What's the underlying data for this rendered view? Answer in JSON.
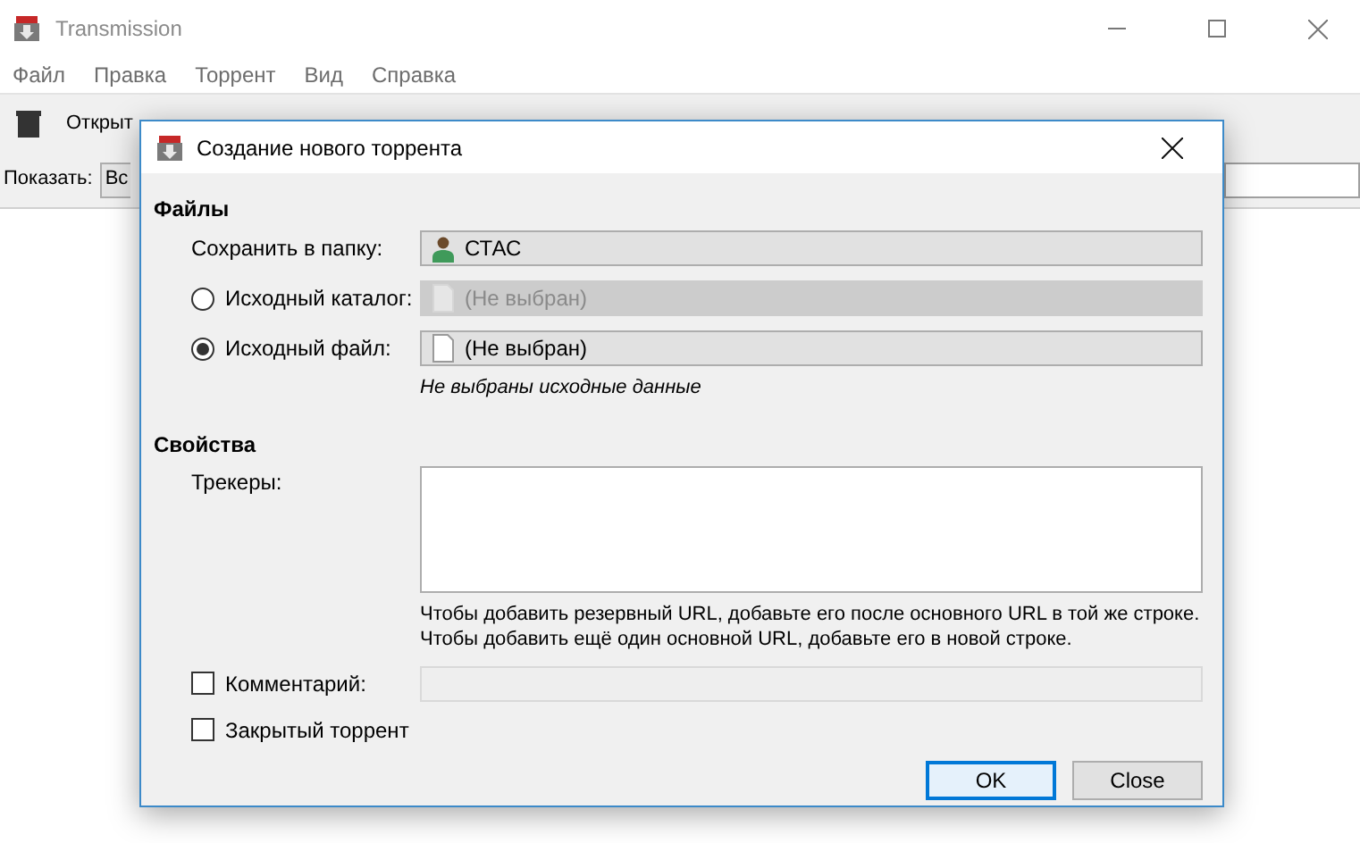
{
  "main_window": {
    "title": "Transmission",
    "menu": [
      "Файл",
      "Правка",
      "Торрент",
      "Вид",
      "Справка"
    ],
    "toolbar": {
      "open_label": "Открыт"
    },
    "filter": {
      "label": "Показать:",
      "value": "Вс"
    }
  },
  "dialog": {
    "title": "Создание нового торрента",
    "files": {
      "heading": "Файлы",
      "rows": [
        {
          "kind": "plain",
          "label": "Сохранить в папку:",
          "value": "СТАС",
          "disabled": false
        },
        {
          "kind": "radio",
          "label": "Исходный каталог:",
          "selected": false,
          "value": "(Не выбран)",
          "disabled": true
        },
        {
          "kind": "radio",
          "label": "Исходный файл:",
          "selected": true,
          "value": "(Не выбран)",
          "disabled": false
        }
      ],
      "message": "Не выбраны исходные данные"
    },
    "properties": {
      "heading": "Свойства",
      "trackers_label": "Трекеры:",
      "hints": [
        "Чтобы добавить резервный URL, добавьте его после основного URL в той же строке.",
        "Чтобы добавить ещё один основной URL, добавьте его в новой строке."
      ],
      "comment": {
        "label": "Комментарий:",
        "checked": false
      },
      "private": {
        "label": "Закрытый торрент",
        "checked": false
      }
    },
    "buttons": [
      {
        "label": "OK",
        "default": true
      },
      {
        "label": "Close",
        "default": false
      }
    ]
  }
}
